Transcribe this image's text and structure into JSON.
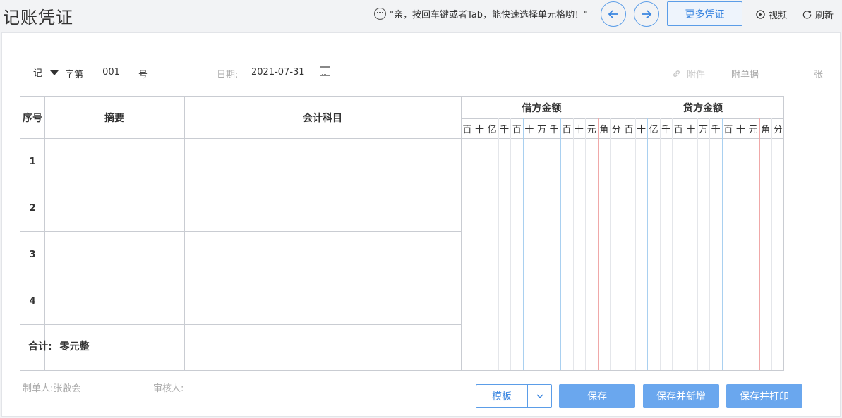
{
  "header": {
    "title": "记账凭证",
    "tip": "\"亲，按回车键或者Tab，能快速选择单元格哟！\"",
    "more_vouchers": "更多凭证",
    "video": "视频",
    "refresh": "刷新"
  },
  "form": {
    "voucher_word": "记",
    "word_label": "字第",
    "voucher_no": "001",
    "no_label": "号",
    "date_label": "日期:",
    "date_value": "2021-07-31",
    "attachment_label": "附件",
    "attached_docs_label": "附单据",
    "attached_docs_unit": "张"
  },
  "table": {
    "col_seq": "序号",
    "col_summary": "摘要",
    "col_account": "会计科目",
    "col_debit": "借方金额",
    "col_credit": "贷方金额",
    "digit_units": [
      "百",
      "十",
      "亿",
      "千",
      "百",
      "十",
      "万",
      "千",
      "百",
      "十",
      "元",
      "角",
      "分"
    ],
    "rows": [
      "1",
      "2",
      "3",
      "4"
    ],
    "total_label": "合计:",
    "total_value": "零元整"
  },
  "footer": {
    "preparer": "制单人:张啟会",
    "reviewer": "审核人:",
    "template": "模板",
    "save": "保存",
    "save_new": "保存并新增",
    "save_print": "保存并打印"
  },
  "colors": {
    "accent": "#5b9de8",
    "button_fill": "#6aa7ee",
    "unit_line_blue": "#a9d0f0",
    "yuan_line_red": "#f0a8a8",
    "grid_line": "#c9ccd2"
  }
}
